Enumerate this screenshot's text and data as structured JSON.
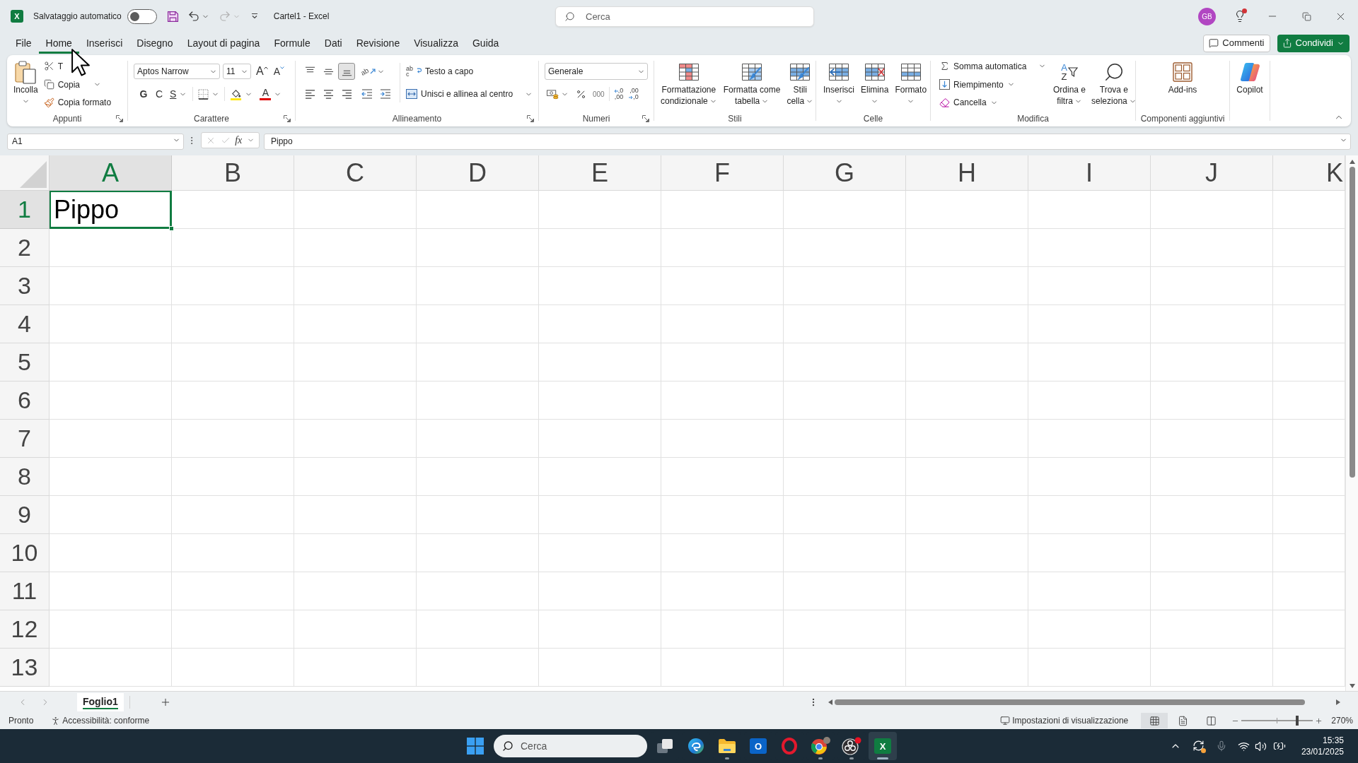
{
  "title_bar": {
    "logo_letter": "X",
    "autosave": {
      "label": "Salvataggio automatico",
      "on": false
    },
    "undo": {
      "disabled": false
    },
    "redo": {
      "disabled": true
    },
    "title": "Cartel1 - Excel",
    "search": {
      "placeholder": "Cerca"
    },
    "account_initials": "GB",
    "tips_badge": true
  },
  "ribbon_tabs": [
    {
      "label": "File",
      "selected": false
    },
    {
      "label": "Home",
      "selected": true
    },
    {
      "label": "Inserisci",
      "selected": false
    },
    {
      "label": "Disegno",
      "selected": false
    },
    {
      "label": "Layout di pagina",
      "selected": false
    },
    {
      "label": "Formule",
      "selected": false
    },
    {
      "label": "Dati",
      "selected": false
    },
    {
      "label": "Revisione",
      "selected": false
    },
    {
      "label": "Visualizza",
      "selected": false
    },
    {
      "label": "Guida",
      "selected": false
    }
  ],
  "comments_button": "Commenti",
  "share_button": "Condividi",
  "ribbon": {
    "clipboard": {
      "label": "Appunti",
      "paste": "Incolla",
      "cut": "T",
      "copy": "Copia",
      "format_painter": "Copia formato"
    },
    "font": {
      "label": "Carattere",
      "font_name": "Aptos Narrow",
      "font_size": "11",
      "grow_font": "A",
      "shrink_font": "A",
      "bold": "G",
      "italic": "C",
      "underline": "S",
      "font_color": "A"
    },
    "alignment": {
      "label": "Allineamento",
      "vertical": [
        {
          "kind": "top",
          "selected": false
        },
        {
          "kind": "middle",
          "selected": false
        },
        {
          "kind": "bottom",
          "selected": true
        }
      ],
      "horizontal": [
        {
          "kind": "left",
          "selected": false
        },
        {
          "kind": "center",
          "selected": false
        },
        {
          "kind": "right",
          "selected": false
        }
      ],
      "orientation_glyph": "ab",
      "wrap_text": {
        "glyph_top": "ab",
        "glyph_bottom": "c",
        "label": "Testo a capo"
      },
      "merge": "Unisci e allinea al centro"
    },
    "number": {
      "label": "Numeri",
      "format": "Generale",
      "thousands": "000",
      "increase_decimal": [
        ",0",
        ",00"
      ],
      "decrease_decimal": [
        ",00",
        ",0"
      ]
    },
    "styles": {
      "label": "Stili",
      "buttons": [
        {
          "kind": "conditional",
          "lines": [
            "Formattazione",
            "condizionale"
          ]
        },
        {
          "kind": "table",
          "lines": [
            "Formatta come",
            "tabella"
          ]
        },
        {
          "kind": "cell_styles",
          "lines": [
            "Stili",
            "cella"
          ]
        }
      ]
    },
    "cells": {
      "label": "Celle",
      "buttons": [
        {
          "kind": "insert",
          "lines": [
            "Inserisci"
          ]
        },
        {
          "kind": "delete",
          "lines": [
            "Elimina"
          ]
        },
        {
          "kind": "format",
          "lines": [
            "Formato"
          ]
        }
      ]
    },
    "editing": {
      "label": "Modifica",
      "autosum": "Somma automatica",
      "fill": "Riempimento",
      "clear": "Cancella",
      "sort": {
        "glyph_top": "A",
        "glyph_bottom": "Z",
        "lines": [
          "Ordina e",
          "filtra"
        ]
      },
      "find": {
        "lines": [
          "Trova e",
          "seleziona"
        ]
      }
    },
    "addins": {
      "label": "Componenti aggiuntivi",
      "button": "Add-ins"
    },
    "copilot": {
      "button": "Copilot"
    }
  },
  "formula_bar": {
    "name_box": "A1",
    "edit_controls_disabled": true,
    "function_glyph": "fx",
    "value": "Pippo"
  },
  "grid": {
    "columns": [
      {
        "label": "A",
        "selected": true
      },
      {
        "label": "B",
        "selected": false
      },
      {
        "label": "C",
        "selected": false
      },
      {
        "label": "D",
        "selected": false
      },
      {
        "label": "E",
        "selected": false
      },
      {
        "label": "F",
        "selected": false
      },
      {
        "label": "G",
        "selected": false
      },
      {
        "label": "H",
        "selected": false
      },
      {
        "label": "I",
        "selected": false
      },
      {
        "label": "J",
        "selected": false
      },
      {
        "label": "K",
        "selected": false
      }
    ],
    "rows": [
      {
        "label": "1",
        "selected": true,
        "cells": [
          {
            "text": "Pippo",
            "selected": true
          }
        ]
      },
      {
        "label": "2",
        "selected": false
      },
      {
        "label": "3",
        "selected": false
      },
      {
        "label": "4",
        "selected": false
      },
      {
        "label": "5",
        "selected": false
      },
      {
        "label": "6",
        "selected": false
      },
      {
        "label": "7",
        "selected": false
      },
      {
        "label": "8",
        "selected": false
      },
      {
        "label": "9",
        "selected": false
      },
      {
        "label": "10",
        "selected": false
      },
      {
        "label": "11",
        "selected": false
      },
      {
        "label": "12",
        "selected": false
      },
      {
        "label": "13",
        "selected": false
      }
    ]
  },
  "sheet_tabs": [
    {
      "label": "Foglio1",
      "selected": true
    }
  ],
  "status_bar": {
    "status": "Pronto",
    "accessibility": "Accessibilità: conforme",
    "display_settings": "Impostazioni di visualizzazione",
    "views": [
      {
        "kind": "normal",
        "selected": true
      },
      {
        "kind": "page_layout",
        "selected": false
      },
      {
        "kind": "page_break",
        "selected": false
      }
    ],
    "zoom": {
      "level": 0.78,
      "reading": "270%"
    }
  },
  "taskbar": {
    "search": {
      "placeholder": "Cerca"
    },
    "apps": [
      {
        "kind": "task_view",
        "running": false,
        "active": false
      },
      {
        "kind": "edge",
        "running": false,
        "active": false
      },
      {
        "kind": "explorer",
        "running": true,
        "active": false
      },
      {
        "kind": "outlook",
        "glyph": "O",
        "running": false,
        "active": false
      },
      {
        "kind": "opera",
        "running": false,
        "active": false
      },
      {
        "kind": "chrome",
        "running": true,
        "active": false
      },
      {
        "kind": "obs",
        "running": true,
        "active": false
      },
      {
        "kind": "excel",
        "glyph": "X",
        "running": true,
        "active": true
      }
    ],
    "time": "15:35",
    "date": "23/01/2025"
  }
}
